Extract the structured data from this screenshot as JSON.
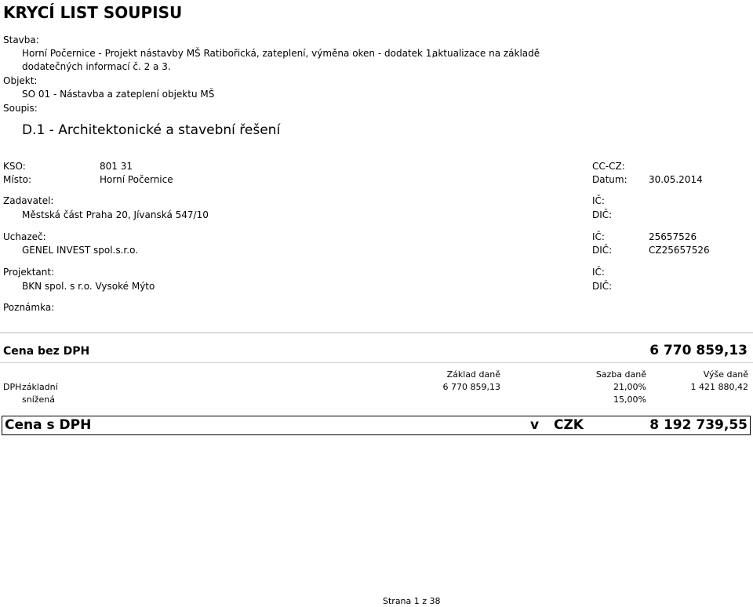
{
  "header": {
    "title": "KRYCÍ LIST SOUPISU"
  },
  "stavba": {
    "label": "Stavba:",
    "line1": "Horní Počernice - Projekt nástavby MŠ Ratibořická, zateplení, výměna oken - dodatek 1,",
    "line1_tail": "aktualizace na základě",
    "line2": "dodatečných informací č. 2 a 3."
  },
  "objekt": {
    "label": "Objekt:",
    "value": "SO 01 - Nástavba a zateplení objektu MŠ"
  },
  "soupis": {
    "label": "Soupis:",
    "value": "D.1 - Architektonické a stavební řešení"
  },
  "info": {
    "kso_label": "KSO:",
    "kso_value": "801 31",
    "ccz_label": "CC-CZ:",
    "misto_label": "Místo:",
    "misto_value": "Horní Počernice",
    "datum_label": "Datum:",
    "datum_value": "30.05.2014"
  },
  "parties": {
    "ic_label": "IČ:",
    "dic_label": "DIČ:",
    "zadavatel_label": "Zadavatel:",
    "zadavatel_value": "Městská část Praha 20, Jívanská 547/10",
    "uchazec_label": "Uchazeč:",
    "uchazec_value": "GENEL INVEST spol.s.r.o.",
    "uchazec_ic": "25657526",
    "uchazec_dic": "CZ25657526",
    "projektant_label": "Projektant:",
    "projektant_value": "BKN spol. s r.o. Vysoké Mýto",
    "poznamka_label": "Poznámka:"
  },
  "totals": {
    "cena_bez_dph_label": "Cena bez DPH",
    "cena_bez_dph_value": "6 770 859,13",
    "col_zaklad": "Základ daně",
    "col_sazba": "Sazba daně",
    "col_vyse": "Výše daně",
    "dph_label": "DPH",
    "zakladni_label": "základní",
    "zakladni_zaklad": "6 770 859,13",
    "zakladni_sazba": "21,00%",
    "zakladni_vyse": "1 421 880,42",
    "snizena_label": "snížená",
    "snizena_sazba": "15,00%",
    "cena_s_dph_label": "Cena s DPH",
    "v_label": "v",
    "currency": "CZK",
    "cena_s_dph_value": "8 192 739,55"
  },
  "footer": {
    "page": "Strana 1 z 38"
  }
}
